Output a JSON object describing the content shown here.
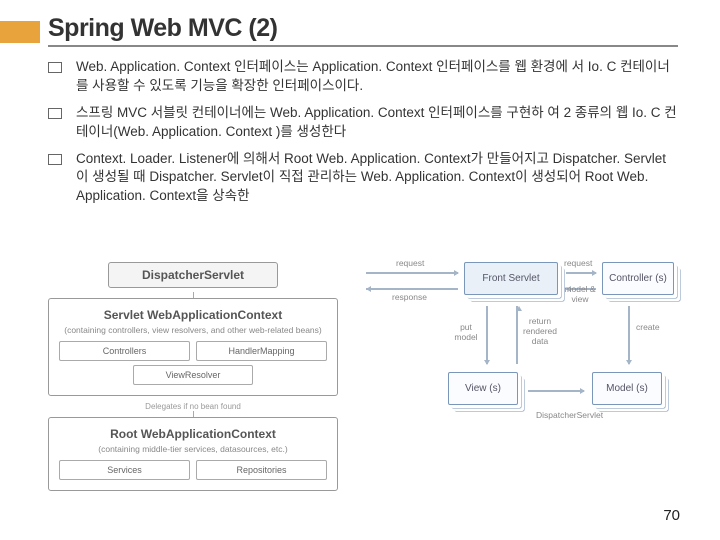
{
  "title": "Spring Web MVC (2)",
  "bullets": [
    "Web. Application. Context 인터페이스는 Application. Context 인터페이스를 웹 환경에 서 Io. C 컨테이너를 사용할 수 있도록 기능을 확장한 인터페이스이다.",
    "스프링 MVC 서블릿 컨테이너에는  Web. Application. Context 인터페이스를 구현하  여 2 종류의 웹 Io. C 컨테이너(Web. Application. Context )를 생성한다",
    "Context. Loader. Listener에 의해서 Root Web. Application. Context가 만들어지고  Dispatcher. Servlet이 생성될 때 Dispatcher. Servlet이 직접 관리하는 Web. Application. Context이 생성되어 Root Web. Application. Context을 상속한"
  ],
  "left_diagram": {
    "top_box_title": "DispatcherServlet",
    "servlet_title": "Servlet WebApplicationContext",
    "servlet_sub": "(containing controllers, view resolvers, and other web-related beans)",
    "inner1a": "Controllers",
    "inner1b": "HandlerMapping",
    "inner2": "ViewResolver",
    "delegates": "Delegates if no bean found",
    "root_title": "Root WebApplicationContext",
    "root_sub": "(containing middle-tier services, datasources, etc.)",
    "rootA": "Services",
    "rootB": "Repositories"
  },
  "right_diagram": {
    "front": "Front Servlet",
    "ctrl": "Controller (s)",
    "view": "View (s)",
    "model": "Model (s)",
    "lbl_req1": "request",
    "lbl_req2": "request",
    "lbl_resp": "response",
    "lbl_mv": "model & view",
    "lbl_put": "put\nmodel",
    "lbl_ret": "return\nrendered\ndata",
    "lbl_dp": "DispatcherServlet",
    "lbl_create": "create"
  },
  "page_number": "70"
}
